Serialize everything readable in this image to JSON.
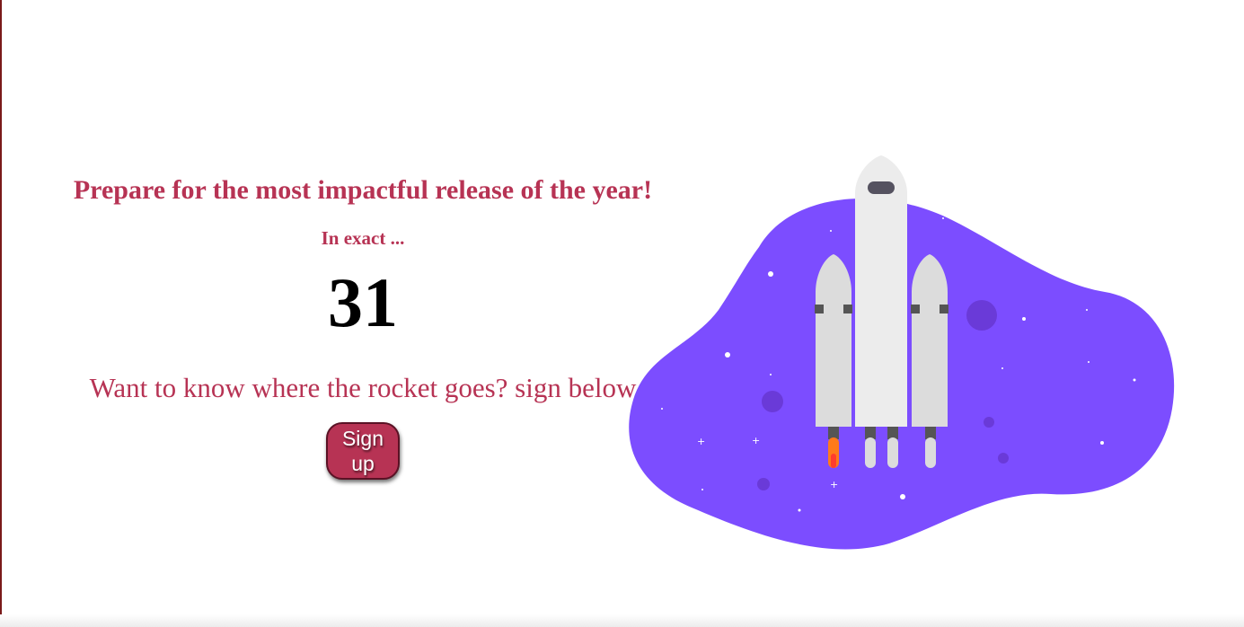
{
  "hero": {
    "headline": "Prepare for the most impactful release of the year!",
    "subline": "In exact ...",
    "countdown": "31",
    "prompt": "Want to know where the rocket goes? sign below",
    "signup_label": "Sign up"
  },
  "colors": {
    "accent": "#b73354",
    "blob": "#7c4dff",
    "rocket": "#ececec"
  },
  "illustration": {
    "icon": "rocket-launch-illustration"
  }
}
